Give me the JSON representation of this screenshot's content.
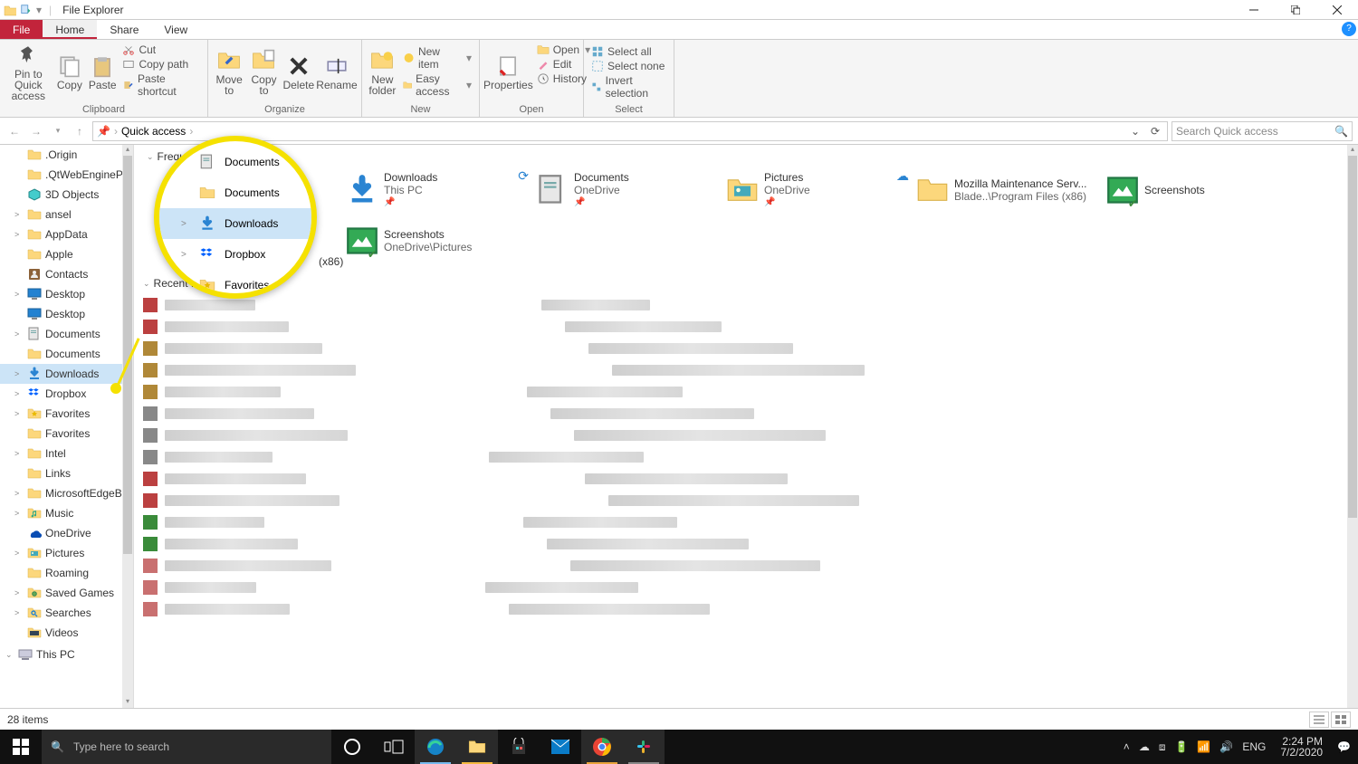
{
  "window": {
    "title": "File Explorer"
  },
  "tabs": {
    "file": "File",
    "home": "Home",
    "share": "Share",
    "view": "View"
  },
  "ribbon": {
    "clipboard": {
      "name": "Clipboard",
      "pin": "Pin to Quick access",
      "copy": "Copy",
      "paste": "Paste",
      "cut": "Cut",
      "copypath": "Copy path",
      "pasteshortcut": "Paste shortcut"
    },
    "organize": {
      "name": "Organize",
      "moveto": "Move to",
      "copyto": "Copy to",
      "delete": "Delete",
      "rename": "Rename"
    },
    "new": {
      "name": "New",
      "newfolder": "New folder",
      "newitem": "New item",
      "easyaccess": "Easy access"
    },
    "open": {
      "name": "Open",
      "properties": "Properties",
      "open": "Open",
      "edit": "Edit",
      "history": "History"
    },
    "select": {
      "name": "Select",
      "all": "Select all",
      "none": "Select none",
      "invert": "Invert selection"
    }
  },
  "address": {
    "crumb": "Quick access",
    "search_placeholder": "Search Quick access"
  },
  "sidebar": [
    {
      "chev": "",
      "icon": "folder",
      "label": ".Origin"
    },
    {
      "chev": "",
      "icon": "folder",
      "label": ".QtWebEngineP"
    },
    {
      "chev": "",
      "icon": "object3d",
      "label": "3D Objects"
    },
    {
      "chev": ">",
      "icon": "folder",
      "label": "ansel"
    },
    {
      "chev": ">",
      "icon": "folder",
      "label": "AppData"
    },
    {
      "chev": "",
      "icon": "folder",
      "label": "Apple"
    },
    {
      "chev": "",
      "icon": "contacts",
      "label": "Contacts"
    },
    {
      "chev": ">",
      "icon": "desktop",
      "label": "Desktop"
    },
    {
      "chev": "",
      "icon": "desktop",
      "label": "Desktop"
    },
    {
      "chev": ">",
      "icon": "documents",
      "label": "Documents"
    },
    {
      "chev": "",
      "icon": "folder",
      "label": "Documents"
    },
    {
      "chev": ">",
      "icon": "downloads",
      "label": "Downloads",
      "selected": true
    },
    {
      "chev": ">",
      "icon": "dropbox",
      "label": "Dropbox"
    },
    {
      "chev": ">",
      "icon": "favorites",
      "label": "Favorites"
    },
    {
      "chev": "",
      "icon": "folder",
      "label": "Favorites"
    },
    {
      "chev": ">",
      "icon": "folder",
      "label": "Intel"
    },
    {
      "chev": "",
      "icon": "folder",
      "label": "Links"
    },
    {
      "chev": ">",
      "icon": "folder",
      "label": "MicrosoftEdgeB"
    },
    {
      "chev": ">",
      "icon": "music",
      "label": "Music"
    },
    {
      "chev": "",
      "icon": "onedrive",
      "label": "OneDrive"
    },
    {
      "chev": ">",
      "icon": "pictures",
      "label": "Pictures"
    },
    {
      "chev": "",
      "icon": "folder",
      "label": "Roaming"
    },
    {
      "chev": ">",
      "icon": "savedgames",
      "label": "Saved Games"
    },
    {
      "chev": ">",
      "icon": "searches",
      "label": "Searches"
    },
    {
      "chev": "",
      "icon": "videos",
      "label": "Videos"
    }
  ],
  "thispc": "This PC",
  "frequent": {
    "header": "Frequent folders",
    "tiles": [
      {
        "name": "Downloads",
        "desc": "This PC",
        "icon": "downloads",
        "pin": true,
        "sync": true
      },
      {
        "name": "Documents",
        "desc": "OneDrive",
        "icon": "documents",
        "pin": true
      },
      {
        "name": "Pictures",
        "desc": "OneDrive",
        "icon": "pictures",
        "pin": true,
        "cloud": true
      },
      {
        "name": "Mozilla Maintenance Serv...",
        "desc": "Blade..\\Program Files (x86)",
        "icon": "folder"
      },
      {
        "name": "Screenshots",
        "desc": "",
        "icon": "picfolder",
        "check": true
      },
      {
        "name": "Screenshots",
        "desc": "OneDrive\\Pictures",
        "icon": "picfolder",
        "check": true
      }
    ]
  },
  "recent": {
    "header": "Recent files (20)",
    "rows": 15
  },
  "status": {
    "items": "28 items"
  },
  "callout": {
    "rows": [
      {
        "chev": "",
        "icon": "documents",
        "label": "Documents"
      },
      {
        "chev": "",
        "icon": "folder",
        "label": "Documents"
      },
      {
        "chev": ">",
        "icon": "downloads",
        "label": "Downloads",
        "selected": true
      },
      {
        "chev": ">",
        "icon": "dropbox",
        "label": "Dropbox"
      },
      {
        "chev": "",
        "icon": "favorites",
        "label": "Favorites"
      }
    ]
  },
  "leaked_text": "(x86)",
  "taskbar": {
    "search": "Type here to search",
    "lang": "ENG",
    "time": "2:24 PM",
    "date": "7/2/2020"
  }
}
